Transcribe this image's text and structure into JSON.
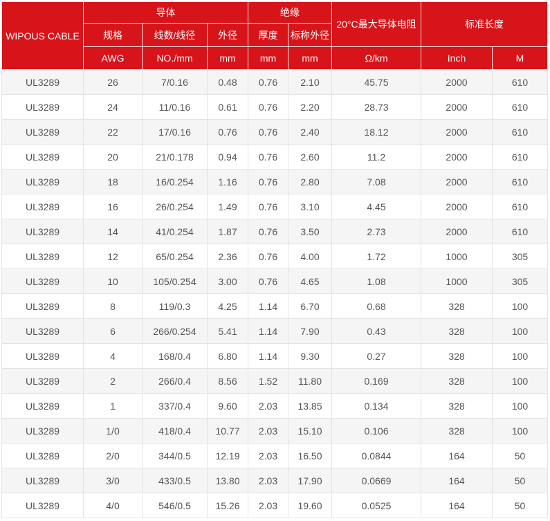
{
  "header": {
    "brand": "WIPOUS CABLE",
    "conductor": "导体",
    "insulation": "绝缘",
    "resistance": "20°C最大导体电阻",
    "std_length": "标准长度",
    "size": "规格",
    "strands": "线数/线径",
    "outer_diameter": "外径",
    "thickness": "厚度",
    "nominal_od": "标称外径",
    "units": {
      "size": "AWG",
      "strands": "NO./mm",
      "outer_diameter": "mm",
      "thickness": "mm",
      "nominal_od": "mm",
      "resistance": "Ω/km",
      "inch": "Inch",
      "meter": "M"
    }
  },
  "rows": [
    [
      "UL3289",
      "26",
      "7/0.16",
      "0.48",
      "0.76",
      "2.10",
      "45.75",
      "2000",
      "610"
    ],
    [
      "UL3289",
      "24",
      "11/0.16",
      "0.61",
      "0.76",
      "2.20",
      "28.73",
      "2000",
      "610"
    ],
    [
      "UL3289",
      "22",
      "17/0.16",
      "0.76",
      "0.76",
      "2.40",
      "18.12",
      "2000",
      "610"
    ],
    [
      "UL3289",
      "20",
      "21/0.178",
      "0.94",
      "0.76",
      "2.60",
      "11.2",
      "2000",
      "610"
    ],
    [
      "UL3289",
      "18",
      "16/0.254",
      "1.16",
      "0.76",
      "2.80",
      "7.08",
      "2000",
      "610"
    ],
    [
      "UL3289",
      "16",
      "26/0.254",
      "1.49",
      "0.76",
      "3.10",
      "4.45",
      "2000",
      "610"
    ],
    [
      "UL3289",
      "14",
      "41/0.254",
      "1.87",
      "0.76",
      "3.50",
      "2.73",
      "2000",
      "610"
    ],
    [
      "UL3289",
      "12",
      "65/0.254",
      "2.36",
      "0.76",
      "4.00",
      "1.72",
      "1000",
      "305"
    ],
    [
      "UL3289",
      "10",
      "105/0.254",
      "3.00",
      "0.76",
      "4.65",
      "1.08",
      "1000",
      "305"
    ],
    [
      "UL3289",
      "8",
      "119/0.3",
      "4.25",
      "1.14",
      "6.70",
      "0.68",
      "328",
      "100"
    ],
    [
      "UL3289",
      "6",
      "266/0.254",
      "5.41",
      "1.14",
      "7.90",
      "0.43",
      "328",
      "100"
    ],
    [
      "UL3289",
      "4",
      "168/0.4",
      "6.80",
      "1.14",
      "9.30",
      "0.27",
      "328",
      "100"
    ],
    [
      "UL3289",
      "2",
      "266/0.4",
      "8.56",
      "1.52",
      "11.80",
      "0.169",
      "328",
      "100"
    ],
    [
      "UL3289",
      "1",
      "337/0.4",
      "9.60",
      "2.03",
      "13.85",
      "0.134",
      "328",
      "100"
    ],
    [
      "UL3289",
      "1/0",
      "418/0.4",
      "10.77",
      "2.03",
      "15.10",
      "0.106",
      "328",
      "100"
    ],
    [
      "UL3289",
      "2/0",
      "344/0.5",
      "12.19",
      "2.03",
      "16.50",
      "0.0844",
      "164",
      "50"
    ],
    [
      "UL3289",
      "3/0",
      "433/0.5",
      "13.80",
      "2.03",
      "17.90",
      "0.0669",
      "164",
      "50"
    ],
    [
      "UL3289",
      "4/0",
      "546/0.5",
      "15.26",
      "2.03",
      "19.60",
      "0.0525",
      "164",
      "50"
    ]
  ],
  "colors": {
    "header_bg": "#d7141a",
    "header_text": "#ffffff",
    "row_alt_bg": "#f5f5f5",
    "cell_text": "#555555",
    "border": "#e3e3e3"
  }
}
